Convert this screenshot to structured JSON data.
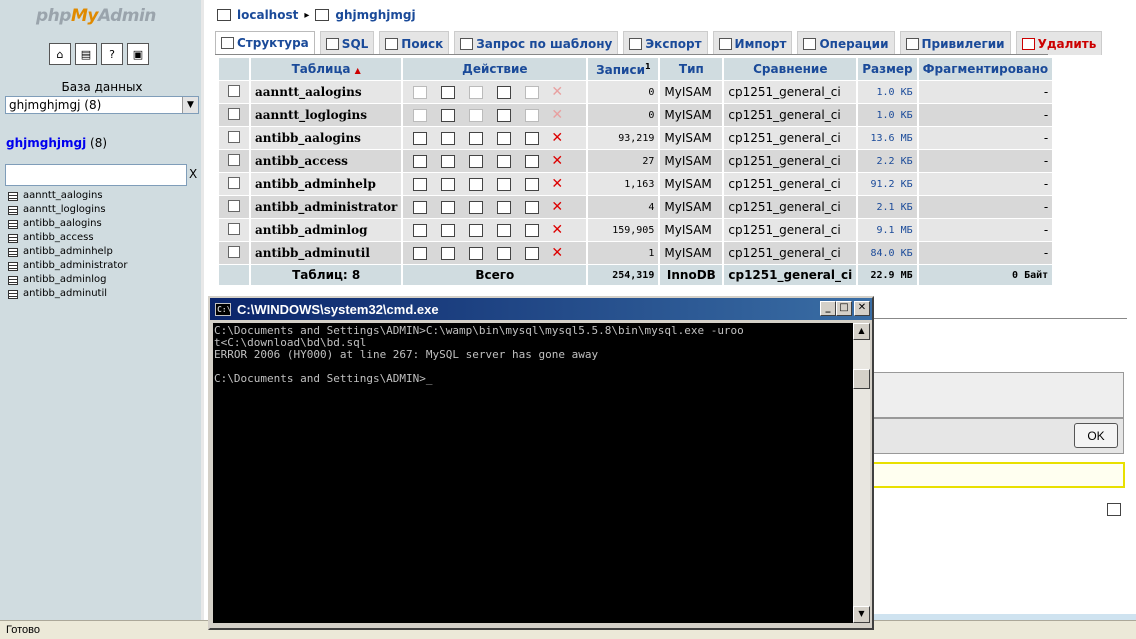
{
  "left": {
    "logo_php": "php",
    "logo_my": "My",
    "logo_admin": "Admin",
    "nav_icons": [
      "home-icon",
      "sql-icon",
      "docs-icon",
      "query-window-icon"
    ],
    "db_label": "База данных",
    "db_select": "ghjmghjmgj (8)",
    "db_name": "ghjmghjmgj",
    "db_count": "(8)",
    "filter_clear": "X",
    "tables": [
      "aanntt_aalogins",
      "aanntt_loglogins",
      "antibb_aalogins",
      "antibb_access",
      "antibb_adminhelp",
      "antibb_administrator",
      "antibb_adminlog",
      "antibb_adminutil"
    ]
  },
  "breadcrumb": {
    "server": "localhost",
    "sep": "▸",
    "db": "ghjmghjmgj"
  },
  "tabs": [
    {
      "label": "Структура",
      "icon": "structure-icon"
    },
    {
      "label": "SQL",
      "icon": "sql-icon"
    },
    {
      "label": "Поиск",
      "icon": "search-icon"
    },
    {
      "label": "Запрос по шаблону",
      "icon": "query-icon"
    },
    {
      "label": "Экспорт",
      "icon": "export-icon"
    },
    {
      "label": "Импорт",
      "icon": "import-icon"
    },
    {
      "label": "Операции",
      "icon": "operations-icon"
    },
    {
      "label": "Привилегии",
      "icon": "privileges-icon"
    },
    {
      "label": "Удалить",
      "icon": "drop-icon"
    }
  ],
  "table": {
    "headers": {
      "table": "Таблица",
      "sort": "▲",
      "action": "Действие",
      "rows": "Записи",
      "rows_sup": "1",
      "type": "Тип",
      "collation": "Сравнение",
      "size": "Размер",
      "overhead": "Фрагментировано"
    },
    "rows": [
      {
        "name": "aanntt_aalogins",
        "records": "0",
        "type": "MyISAM",
        "collation": "cp1251_general_ci",
        "size": "1.0 КБ",
        "overhead": "-"
      },
      {
        "name": "aanntt_loglogins",
        "records": "0",
        "type": "MyISAM",
        "collation": "cp1251_general_ci",
        "size": "1.0 КБ",
        "overhead": "-"
      },
      {
        "name": "antibb_aalogins",
        "records": "93,219",
        "type": "MyISAM",
        "collation": "cp1251_general_ci",
        "size": "13.6 МБ",
        "overhead": "-"
      },
      {
        "name": "antibb_access",
        "records": "27",
        "type": "MyISAM",
        "collation": "cp1251_general_ci",
        "size": "2.2 КБ",
        "overhead": "-"
      },
      {
        "name": "antibb_adminhelp",
        "records": "1,163",
        "type": "MyISAM",
        "collation": "cp1251_general_ci",
        "size": "91.2 КБ",
        "overhead": "-"
      },
      {
        "name": "antibb_administrator",
        "records": "4",
        "type": "MyISAM",
        "collation": "cp1251_general_ci",
        "size": "2.1 КБ",
        "overhead": "-"
      },
      {
        "name": "antibb_adminlog",
        "records": "159,905",
        "type": "MyISAM",
        "collation": "cp1251_general_ci",
        "size": "9.1 МБ",
        "overhead": "-"
      },
      {
        "name": "antibb_adminutil",
        "records": "1",
        "type": "MyISAM",
        "collation": "cp1251_general_ci",
        "size": "84.0 КБ",
        "overhead": "-"
      }
    ],
    "footer": {
      "tables": "Таблиц: 8",
      "total": "Всего",
      "records": "254,319",
      "type": "InnoDB",
      "collation": "cp1251_general_ci",
      "size": "22.9 МБ",
      "overhead": "0 Байт"
    }
  },
  "ok_button": "OK",
  "status": "Готово",
  "cmd": {
    "title": "C:\\WINDOWS\\system32\\cmd.exe",
    "icon_text": "C:\\",
    "minimize": "_",
    "maximize": "□",
    "close": "✕",
    "console": "C:\\Documents and Settings\\ADMIN>C:\\wamp\\bin\\mysql\\mysql5.5.8\\bin\\mysql.exe -uroo\nt<C:\\download\\bd\\bd.sql\nERROR 2006 (HY000) at line 267: MySQL server has gone away\n\nC:\\Documents and Settings\\ADMIN>_",
    "scroll_up": "▲",
    "scroll_down": "▼"
  }
}
